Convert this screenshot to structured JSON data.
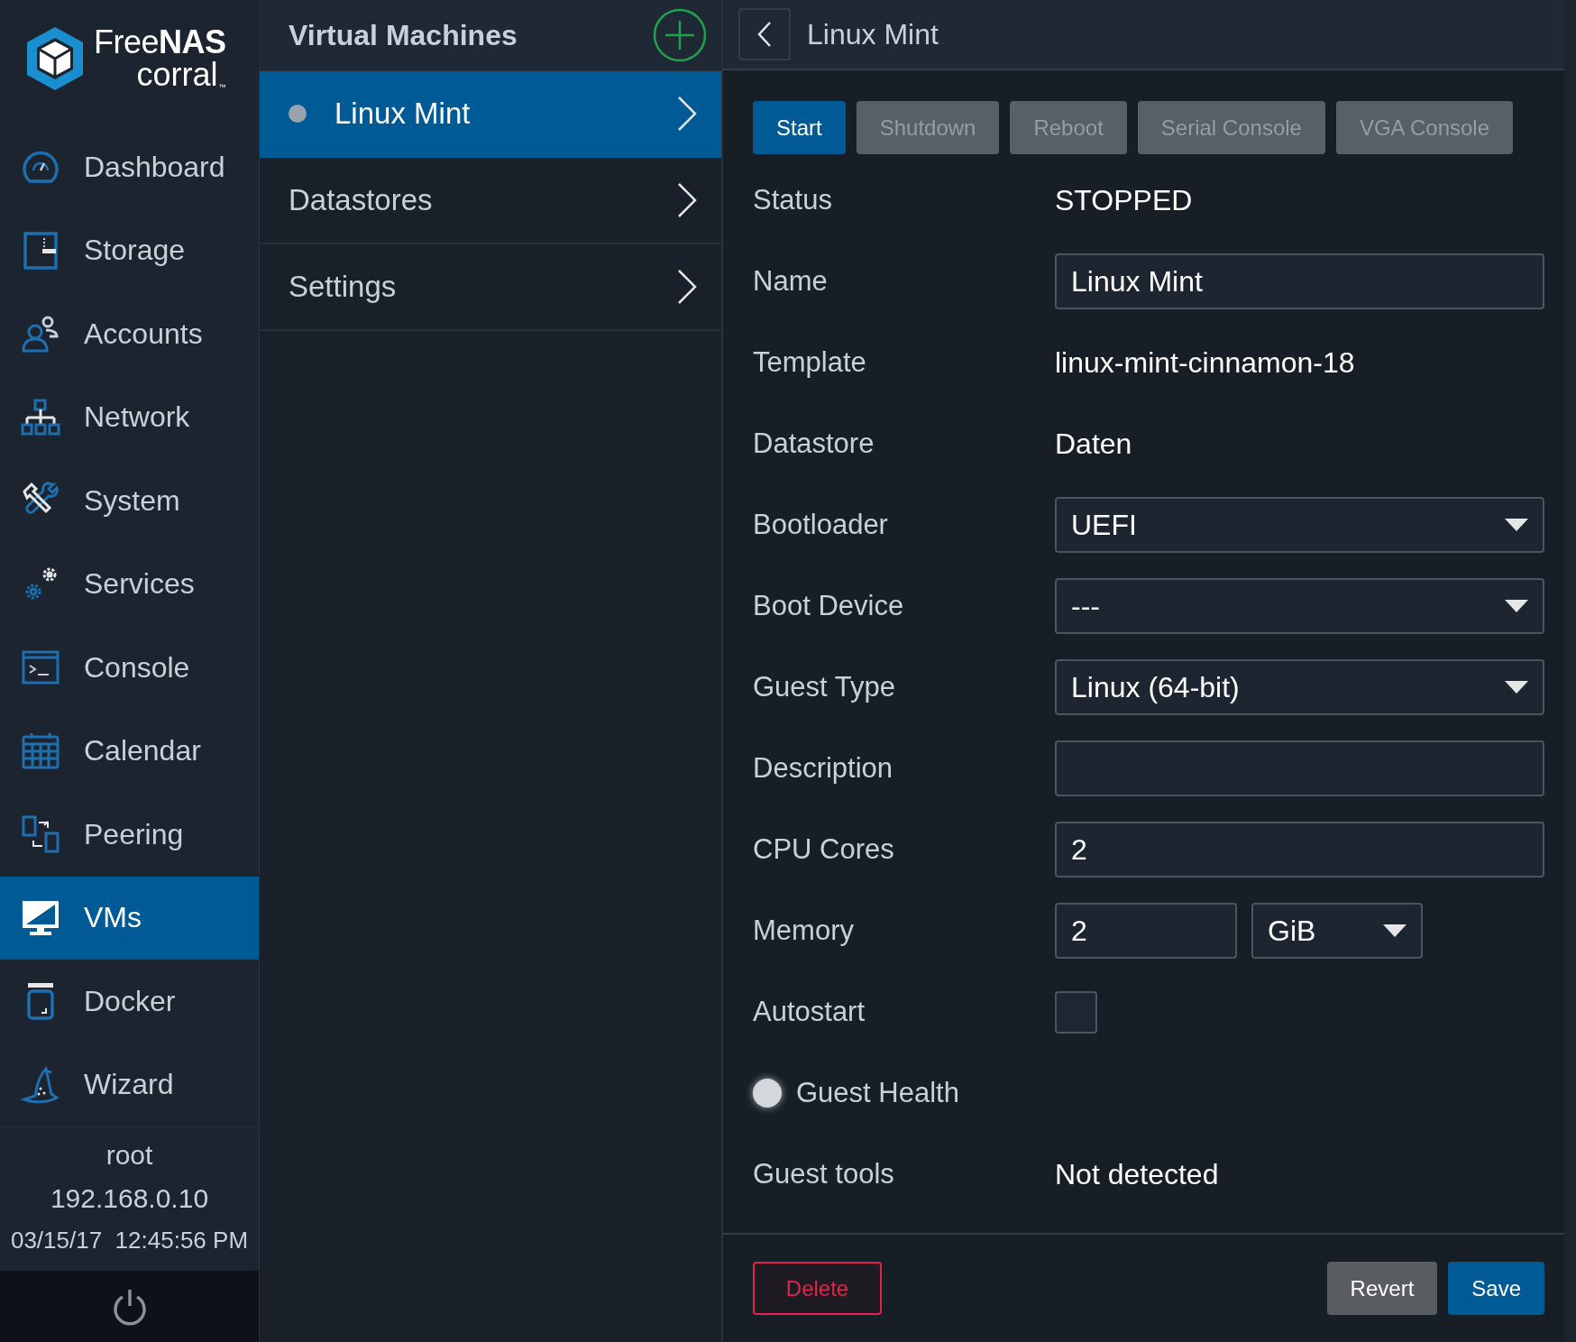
{
  "logo": {
    "brand": "Free**NAS**",
    "product": "corral",
    "mark": "™"
  },
  "nav": [
    {
      "label": "Dashboard",
      "selected": false
    },
    {
      "label": "Storage",
      "selected": false
    },
    {
      "label": "Accounts",
      "selected": false
    },
    {
      "label": "Network",
      "selected": false
    },
    {
      "label": "System",
      "selected": false
    },
    {
      "label": "Services",
      "selected": false
    },
    {
      "label": "Console",
      "selected": false
    },
    {
      "label": "Calendar",
      "selected": false
    },
    {
      "label": "Peering",
      "selected": false
    },
    {
      "label": "VMs",
      "selected": true
    },
    {
      "label": "Docker",
      "selected": false
    },
    {
      "label": "Wizard",
      "selected": false
    }
  ],
  "session": {
    "user": "root",
    "ip": "192.168.0.10",
    "date": "03/15/17",
    "time": "12:45:56 PM"
  },
  "vm_list": {
    "title": "Virtual Machines",
    "items": [
      {
        "label": "Linux Mint",
        "kind": "vm",
        "selected": true
      },
      {
        "label": "Datastores",
        "kind": "section",
        "selected": false
      },
      {
        "label": "Settings",
        "kind": "section",
        "selected": false
      }
    ]
  },
  "detail": {
    "title": "Linux Mint",
    "actions": [
      {
        "label": "Start",
        "disabled": false
      },
      {
        "label": "Shutdown",
        "disabled": true
      },
      {
        "label": "Reboot",
        "disabled": true
      },
      {
        "label": "Serial Console",
        "disabled": true
      },
      {
        "label": "VGA Console",
        "disabled": true
      }
    ],
    "fields": [
      {
        "kind": "text",
        "label": "Status",
        "value": "STOPPED"
      },
      {
        "kind": "input",
        "label": "Name",
        "value": "Linux Mint"
      },
      {
        "kind": "text",
        "label": "Template",
        "value": "linux-mint-cinnamon-18"
      },
      {
        "kind": "text",
        "label": "Datastore",
        "value": "Daten"
      },
      {
        "kind": "select",
        "label": "Bootloader",
        "value": "UEFI"
      },
      {
        "kind": "select",
        "label": "Boot Device",
        "value": "---"
      },
      {
        "kind": "select",
        "label": "Guest Type",
        "value": "Linux (64-bit)"
      },
      {
        "kind": "input",
        "label": "Description"
      },
      {
        "kind": "input",
        "label": "CPU Cores",
        "value": "2"
      },
      {
        "kind": "memory",
        "label": "Memory",
        "value": "2",
        "unit": "GiB"
      },
      {
        "kind": "checkbox",
        "label": "Autostart",
        "checked": false
      },
      {
        "kind": "health",
        "label": "Guest Health"
      },
      {
        "kind": "text",
        "label": "Guest tools",
        "value": "Not detected"
      }
    ],
    "footer": {
      "delete": "Delete",
      "revert": "Revert",
      "save": "Save"
    }
  }
}
